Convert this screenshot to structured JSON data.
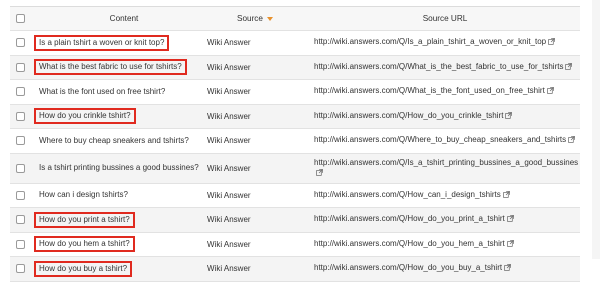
{
  "table": {
    "columns": {
      "content": "Content",
      "source": "Source",
      "source_url": "Source URL"
    },
    "sort": {
      "column": "source",
      "direction": "desc"
    },
    "rows": [
      {
        "content": "Is a plain tshirt a woven or knit top?",
        "source": "Wiki Answer",
        "url": "http://wiki.answers.com/Q/Is_a_plain_tshirt_a_woven_or_knit_top",
        "highlighted": true
      },
      {
        "content": "What is the best fabric to use for tshirts?",
        "source": "Wiki Answer",
        "url": "http://wiki.answers.com/Q/What_is_the_best_fabric_to_use_for_tshirts",
        "highlighted": true
      },
      {
        "content": "What is the font used on free tshirt?",
        "source": "Wiki Answer",
        "url": "http://wiki.answers.com/Q/What_is_the_font_used_on_free_tshirt",
        "highlighted": false
      },
      {
        "content": "How do you crinkle tshirt?",
        "source": "Wiki Answer",
        "url": "http://wiki.answers.com/Q/How_do_you_crinkle_tshirt",
        "highlighted": true
      },
      {
        "content": "Where to buy cheap sneakers and tshirts?",
        "source": "Wiki Answer",
        "url": "http://wiki.answers.com/Q/Where_to_buy_cheap_sneakers_and_tshirts",
        "highlighted": false
      },
      {
        "content": "Is a tshirt printing bussines a good bussines?",
        "source": "Wiki Answer",
        "url": "http://wiki.answers.com/Q/Is_a_tshirt_printing_bussines_a_good_bussines",
        "highlighted": false
      },
      {
        "content": "How can i design tshirts?",
        "source": "Wiki Answer",
        "url": "http://wiki.answers.com/Q/How_can_i_design_tshirts",
        "highlighted": false
      },
      {
        "content": "How do you print a tshirt?",
        "source": "Wiki Answer",
        "url": "http://wiki.answers.com/Q/How_do_you_print_a_tshirt",
        "highlighted": true
      },
      {
        "content": "How do you hem a tshirt?",
        "source": "Wiki Answer",
        "url": "http://wiki.answers.com/Q/How_do_you_hem_a_tshirt",
        "highlighted": true
      },
      {
        "content": "How do you buy a tshirt?",
        "source": "Wiki Answer",
        "url": "http://wiki.answers.com/Q/How_do_you_buy_a_tshirt",
        "highlighted": true
      }
    ]
  },
  "icons": {
    "external_link": "external-link-icon",
    "sort": "sort-caret-down-icon"
  },
  "colors": {
    "highlight_border": "#e02a1f",
    "sort_accent": "#e8912d",
    "header_bg": "#f7f7f7",
    "row_alt_bg": "#f4f4f4"
  }
}
